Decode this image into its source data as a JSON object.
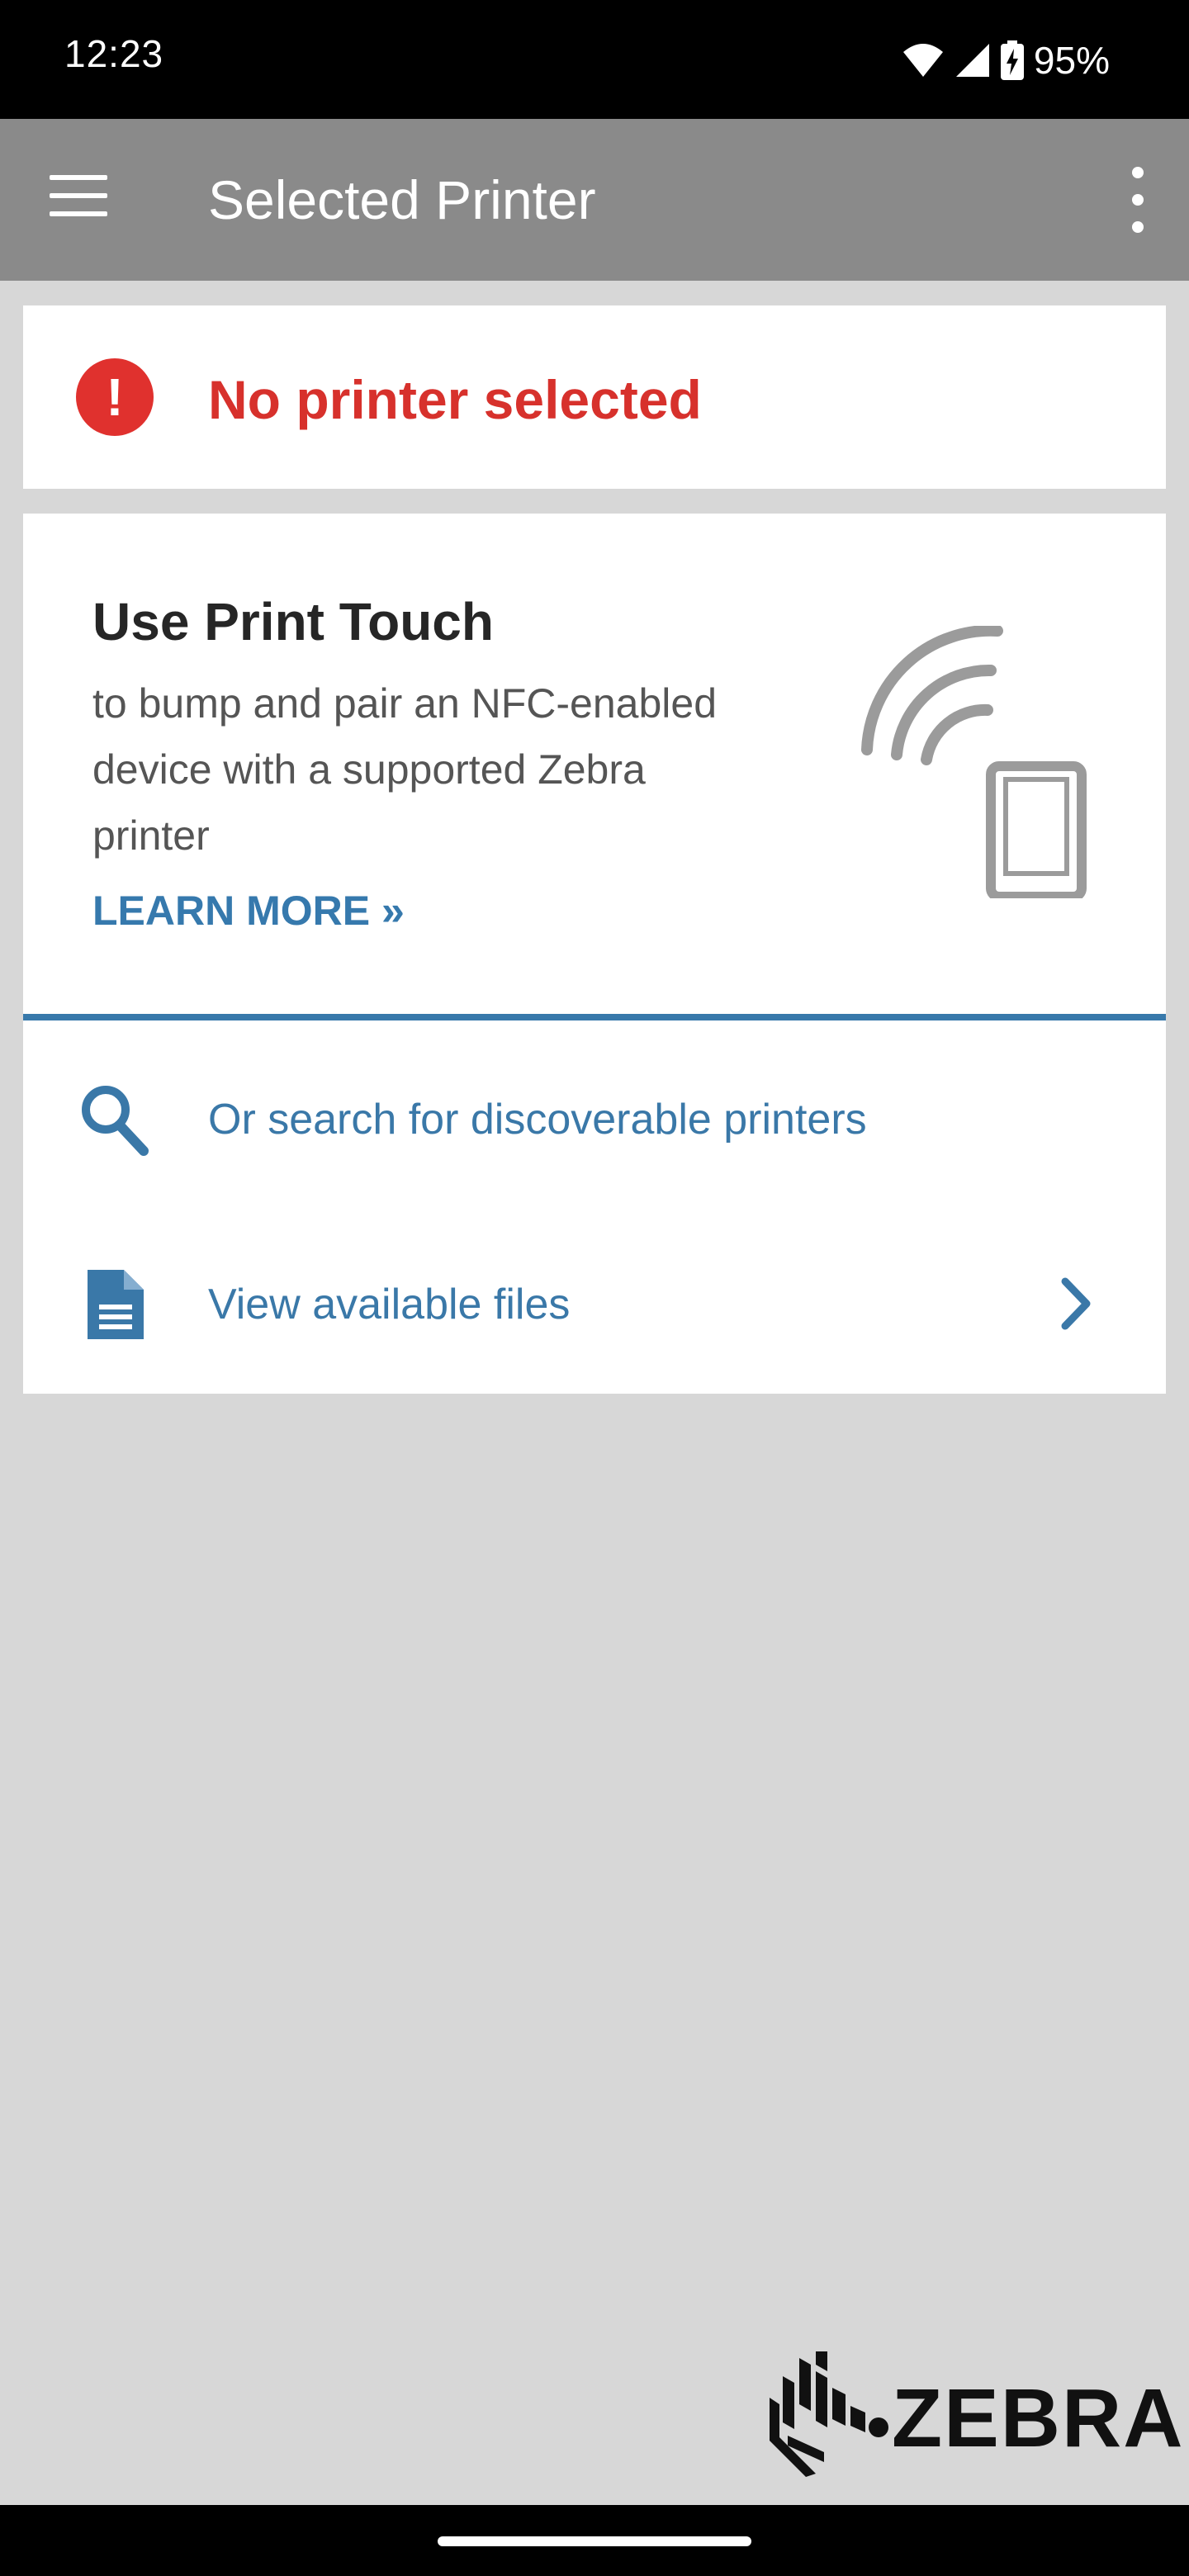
{
  "status_bar": {
    "time": "12:23",
    "battery": "95%",
    "icons": [
      "wifi-icon",
      "signal-icon",
      "battery-charging-icon"
    ]
  },
  "app_bar": {
    "title": "Selected Printer",
    "menu_icon": "hamburger-menu-icon",
    "overflow_icon": "more-vert-icon",
    "background": "#8a8a8a"
  },
  "alert": {
    "text": "No printer selected",
    "icon": "error-icon",
    "color": "#d7312c"
  },
  "print_touch": {
    "title": "Use Print Touch",
    "body": "to bump and pair an NFC-enabled device with a supported Zebra printer",
    "link": "LEARN MORE »",
    "graphic": "nfc-phone-icon"
  },
  "actions": [
    {
      "label": "Or search for discoverable printers",
      "icon": "search-icon"
    },
    {
      "label": "View available files",
      "icon": "document-icon",
      "trailing_icon": "chevron-right-icon"
    }
  ],
  "brand": {
    "name": "ZEBRA",
    "accent": "#3879ab"
  }
}
